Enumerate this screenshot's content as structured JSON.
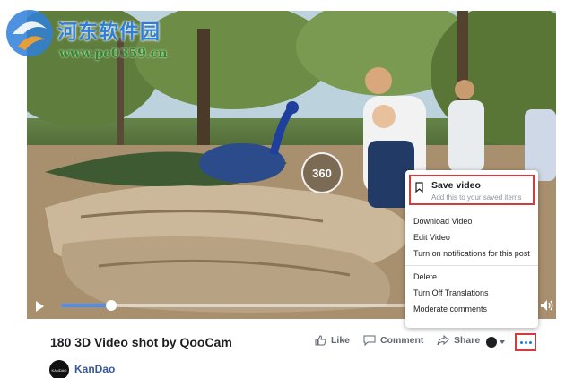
{
  "watermark": {
    "site_name": "河东软件园",
    "url": "www.pc0359.cn"
  },
  "video": {
    "badge_label": "360",
    "progress_fraction": 0.11,
    "accent_color": "#4d8df0"
  },
  "menu": {
    "save_title": "Save video",
    "save_subtitle": "Add this to your saved items",
    "group1": [
      "Download Video",
      "Edit Video",
      "Turn on notifications for this post"
    ],
    "group2": [
      "Delete",
      "Turn Off Translations",
      "Moderate comments"
    ]
  },
  "post": {
    "title": "180 3D Video shot by QooCam",
    "like_label": "Like",
    "comment_label": "Comment",
    "share_label": "Share",
    "author": "KanDao",
    "avatar_text": "KANDAO"
  },
  "highlight_color": "#d73a3a"
}
